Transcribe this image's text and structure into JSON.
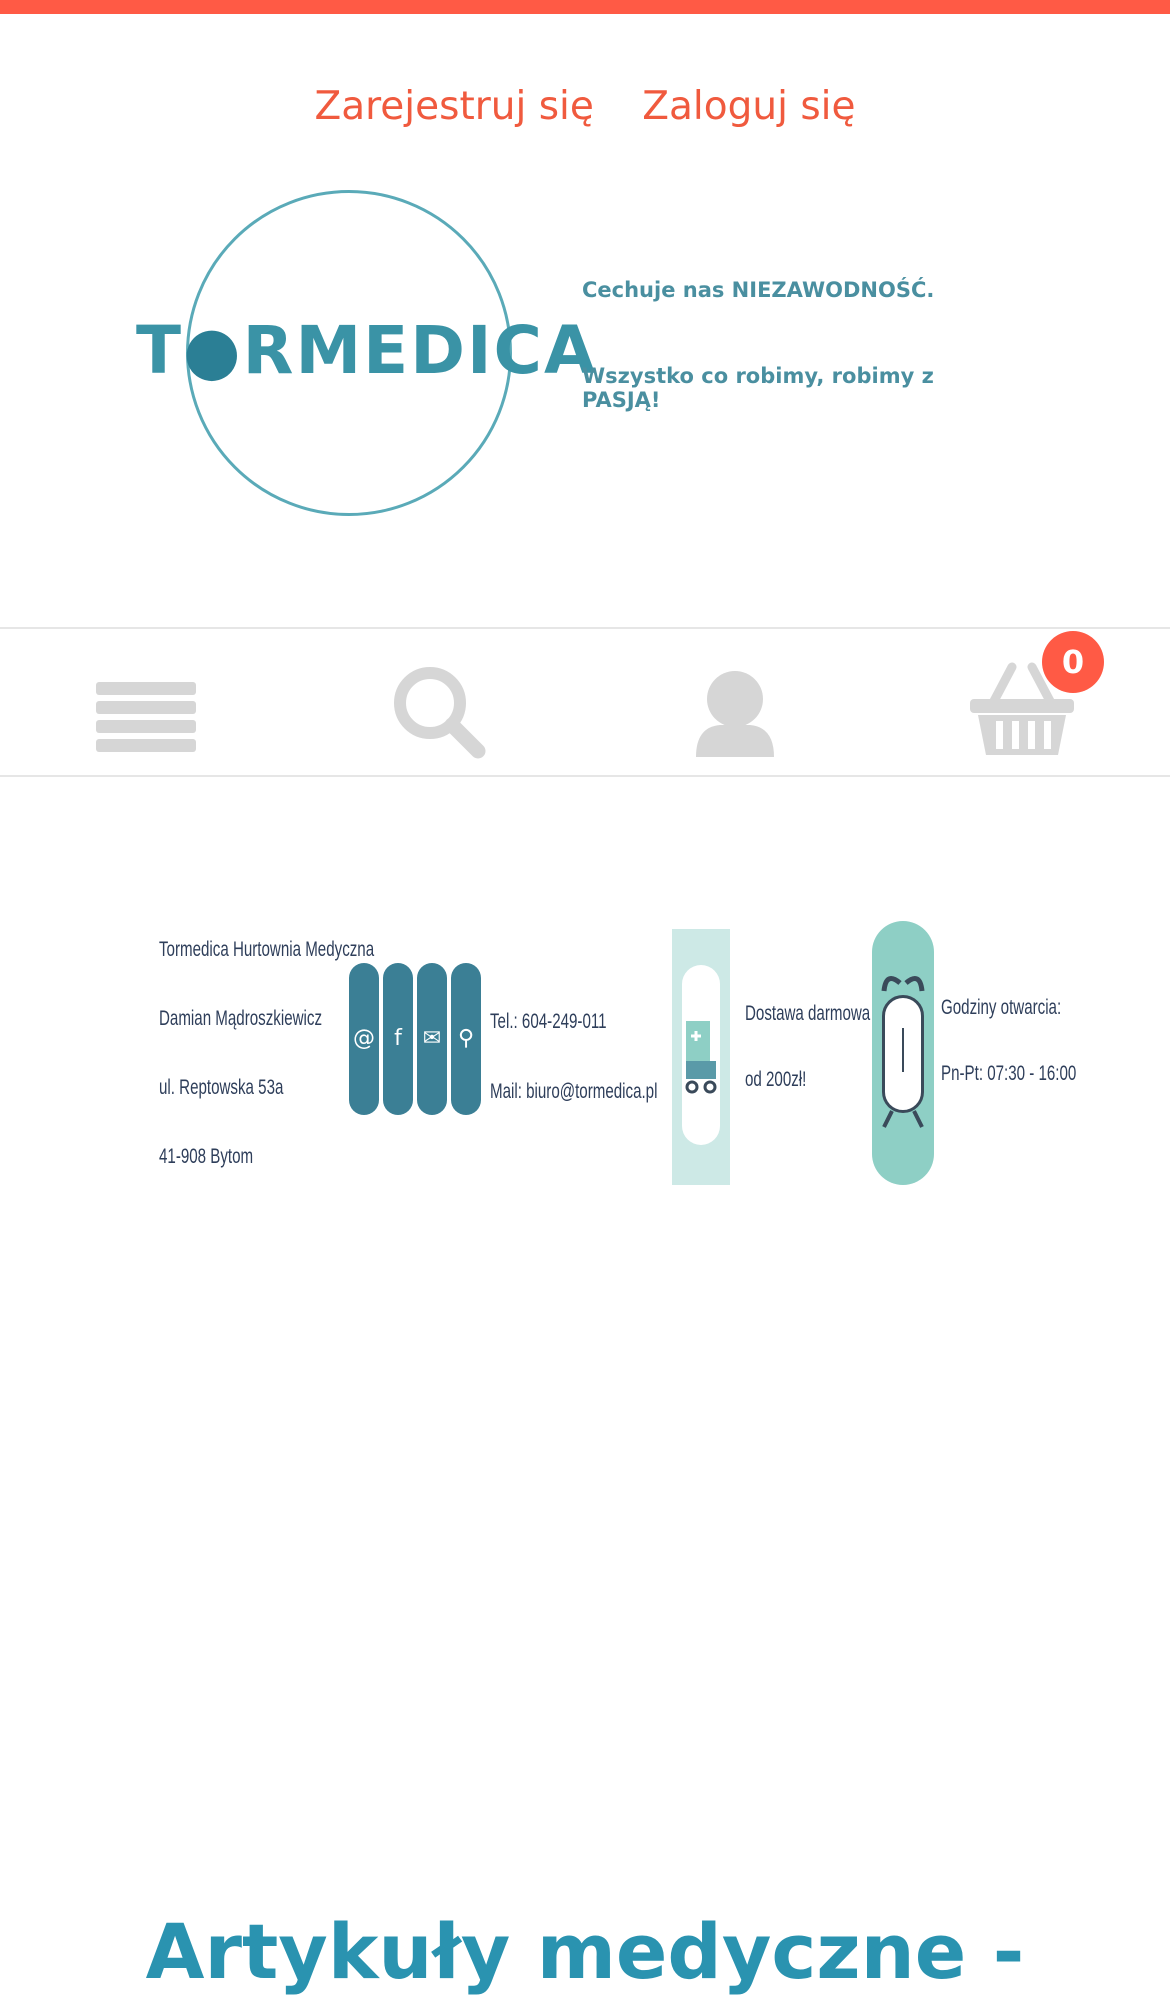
{
  "colors": {
    "accent": "#ff5a45",
    "link": "#f05a3e",
    "icon_gray": "#d6d6d6",
    "brand_teal": "#3a93a6",
    "heading": "#2a93b0"
  },
  "header": {
    "register_label": "Zarejestruj się",
    "login_label": "Zaloguj się"
  },
  "logo": {
    "brand_left": "T",
    "brand_right": "RMEDICA",
    "tagline_1": "Cechuje nas NIEZAWODNOŚĆ.",
    "tagline_2": "Wszystko co robimy, robimy z PASJĄ!"
  },
  "navbar": {
    "icons": [
      "menu-icon",
      "search-icon",
      "user-icon",
      "cart-icon"
    ],
    "cart_count": "0"
  },
  "banner": {
    "company_lines": [
      "Tormedica Hurtownia Medyczna",
      "Damian Mądroszkiewicz",
      "ul. Reptowska 53a",
      "41-908 Bytom"
    ],
    "contact_icons": [
      "@",
      "f",
      "✉",
      "⚲"
    ],
    "phone": "Tel.: 604-249-011",
    "mail": "Mail: biuro@tormedica.pl",
    "delivery_line_1": "Dostawa darmowa",
    "delivery_line_2": "od 200zł!",
    "hours_line_1": "Godziny otwarcia:",
    "hours_line_2": "Pn-Pt: 07:30 - 16:00"
  },
  "main": {
    "heading": "Artykuły medyczne -"
  }
}
